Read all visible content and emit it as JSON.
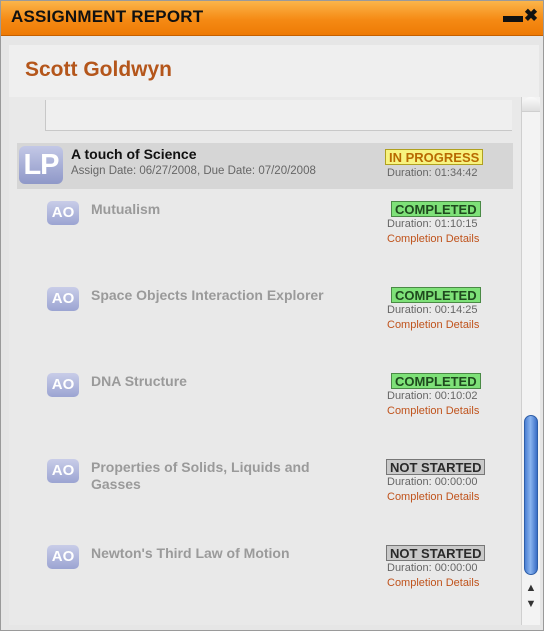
{
  "window": {
    "title": "ASSIGNMENT REPORT",
    "minimize_glyph": "▬",
    "close_glyph": "✖"
  },
  "student": {
    "name": "Scott Goldwyn"
  },
  "learning_path": {
    "icon": "LP",
    "title": "A touch of Science",
    "dates": "Assign Date: 06/27/2008, Due Date: 07/20/2008",
    "status": "IN PROGRESS",
    "duration": "Duration: 01:34:42"
  },
  "activities": [
    {
      "icon": "AO",
      "title": "Mutualism",
      "status": "COMPLETED",
      "duration": "Duration: 01:10:15",
      "details": "Completion Details"
    },
    {
      "icon": "AO",
      "title": "Space Objects Interaction Explorer",
      "status": "COMPLETED",
      "duration": "Duration: 00:14:25",
      "details": "Completion Details"
    },
    {
      "icon": "AO",
      "title": "DNA Structure",
      "status": "COMPLETED",
      "duration": "Duration: 00:10:02",
      "details": "Completion Details"
    },
    {
      "icon": "AO",
      "title": "Properties of Solids, Liquids and Gasses",
      "status": "NOT STARTED",
      "duration": "Duration: 00:00:00",
      "details": "Completion Details"
    },
    {
      "icon": "AO",
      "title": "Newton's Third Law of Motion",
      "status": "NOT STARTED",
      "duration": "Duration: 00:00:00",
      "details": "Completion Details"
    }
  ],
  "scrollbar": {
    "up_glyph": "▲",
    "down_glyph": "▼"
  },
  "colors": {
    "titlebar": "#f58a14",
    "name": "#b4561b",
    "completed": "#7ee178",
    "in_progress": "#f7f37f",
    "not_started": "#c9c9c9",
    "link": "#c0531c"
  }
}
